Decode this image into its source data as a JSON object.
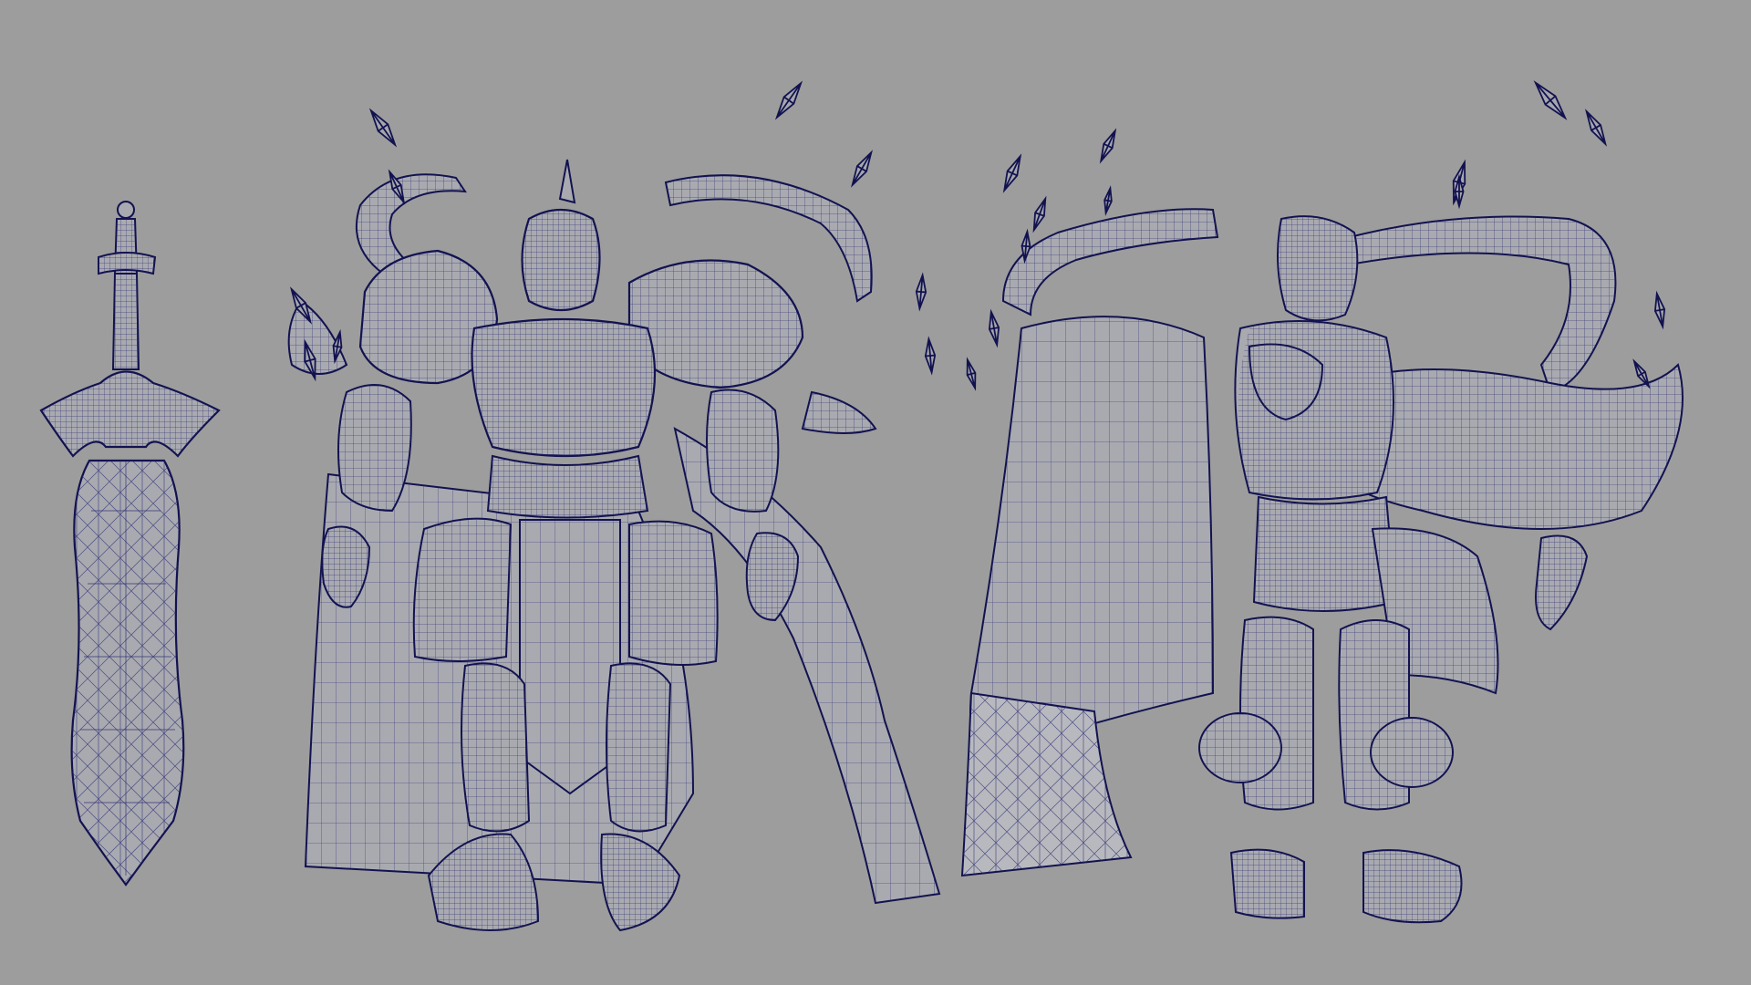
{
  "viewport": {
    "background_color": "#9d9d9d",
    "wire_color": "#1e1e6e",
    "shade_color": "#a9aab0"
  },
  "models": [
    {
      "name": "sword",
      "view": "front"
    },
    {
      "name": "armored-knight",
      "view": "front"
    },
    {
      "name": "armored-knight",
      "view": "back"
    }
  ],
  "icons": {
    "crystal": "crystal-shard-icon"
  }
}
